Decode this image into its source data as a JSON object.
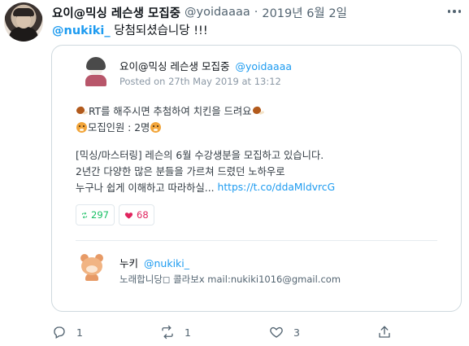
{
  "tweet": {
    "author_name": "요이@믹싱 레슨생 모집중",
    "author_handle": "@yoidaaaa",
    "separator": "·",
    "date": "2019년 6월 2일",
    "reply_mention": "@nukiki_",
    "reply_text": " 당첨되셨습니당 !!!"
  },
  "quote": {
    "author_name": "요이@믹싱 레슨생 모집중",
    "author_handle": "@yoidaaaa",
    "posted": "Posted on 27th May 2019 at 13:12",
    "line1": "RT를 해주시면 추첨하여 치킨을 드려요",
    "line2": "모집인원 : 2명",
    "line3": "[믹싱/마스터링] 레슨의 6월 수강생분을 모집하고 있습니다.",
    "line4": "2년간 다양한 많은 분들을 가르쳐 드렸던 노하우로",
    "line5": "누구나 쉽게 이해하고 따라하실...",
    "link": "https://t.co/ddaMldvrcG",
    "retweets": "297",
    "likes": "68",
    "reply_author_name": "누키",
    "reply_author_handle": "@nukiki_",
    "reply_author_bio": "노래합니당◻ 콜라보x mail:nukiki1016@gmail.com"
  },
  "actions": {
    "reply_count": "1",
    "retweet_count": "1",
    "like_count": "3"
  },
  "colors": {
    "accent": "#1d9bf0",
    "retweet_green": "#17bf63",
    "like_red": "#e0245e",
    "muted": "#536471"
  },
  "icons": [
    "more-icon",
    "retweet-icon",
    "heart-icon",
    "reply-icon",
    "like-icon",
    "share-icon"
  ]
}
